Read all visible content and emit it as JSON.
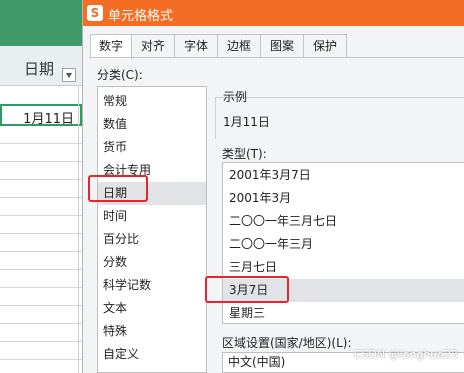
{
  "sheet": {
    "column_header": "日期",
    "selected_cell": "1月11日"
  },
  "dialog": {
    "app_icon_letter": "S",
    "title": "单元格格式",
    "tabs": [
      {
        "label": "数字"
      },
      {
        "label": "对齐"
      },
      {
        "label": "字体"
      },
      {
        "label": "边框"
      },
      {
        "label": "图案"
      },
      {
        "label": "保护"
      }
    ],
    "active_tab": "数字",
    "category_label": "分类(C):",
    "categories": [
      {
        "label": "常规"
      },
      {
        "label": "数值"
      },
      {
        "label": "货币"
      },
      {
        "label": "会计专用"
      },
      {
        "label": "日期"
      },
      {
        "label": "时间"
      },
      {
        "label": "百分比"
      },
      {
        "label": "分数"
      },
      {
        "label": "科学记数"
      },
      {
        "label": "文本"
      },
      {
        "label": "特殊"
      },
      {
        "label": "自定义"
      }
    ],
    "selected_category": "日期",
    "preview_label": "示例",
    "preview_value": "1月11日",
    "type_label": "类型(T):",
    "types": [
      {
        "label": "2001年3月7日"
      },
      {
        "label": "2001年3月"
      },
      {
        "label": "二〇〇一年三月七日"
      },
      {
        "label": "二〇〇一年三月"
      },
      {
        "label": "三月七日"
      },
      {
        "label": "3月7日"
      },
      {
        "label": "星期三"
      }
    ],
    "selected_type": "3月7日",
    "locale_label": "区域设置(国家/地区)(L):",
    "locale_value": "中文(中国)"
  },
  "watermark": "CSDN @longhua23",
  "colors": {
    "title_bar": "#f46d24",
    "highlight_box": "#e8252c",
    "sheet_accent": "#2e9b63"
  }
}
